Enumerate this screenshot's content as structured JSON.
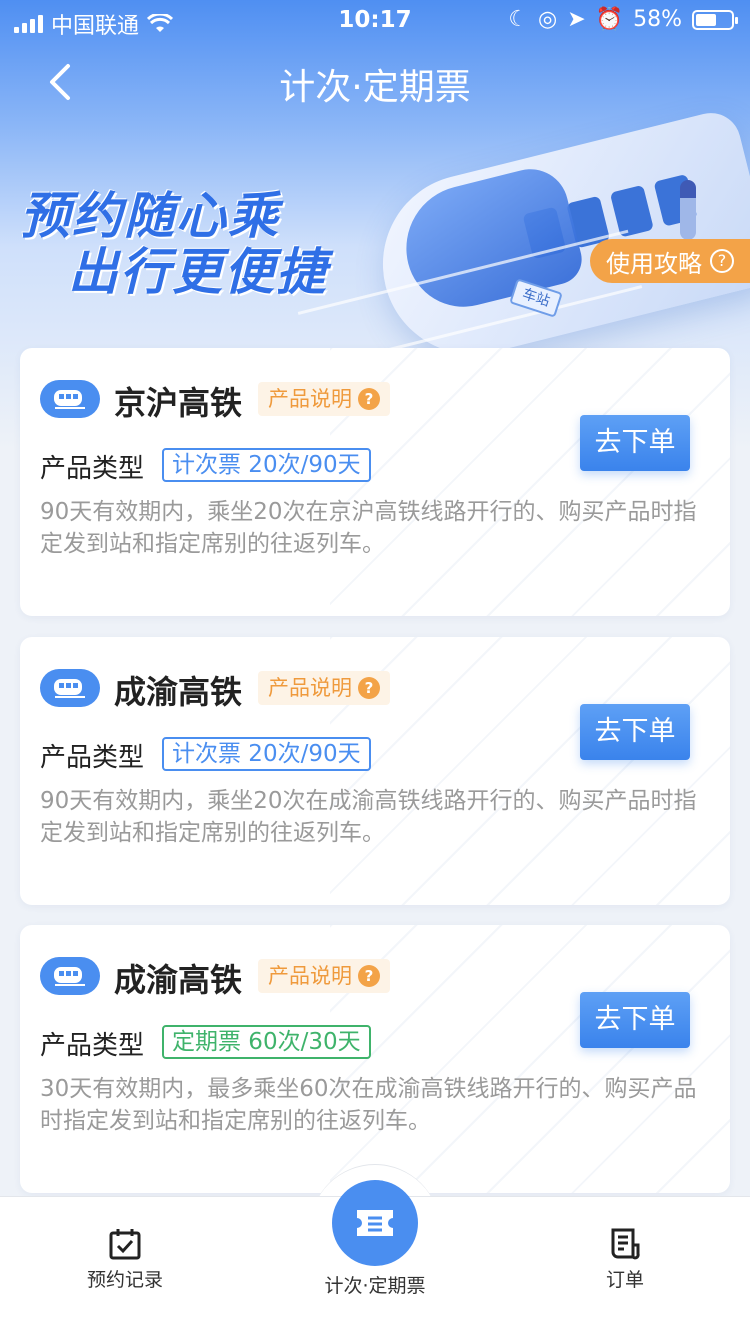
{
  "status_bar": {
    "carrier": "中国联通",
    "time": "10:17",
    "battery": "58%"
  },
  "nav": {
    "title": "计次·定期票"
  },
  "hero": {
    "slogan_line1": "预约随心乘",
    "slogan_line2": "出行更便捷",
    "station_sign": "车站",
    "guide_button": "使用攻略"
  },
  "cards": [
    {
      "name": "京沪高铁",
      "info_tag": "产品说明",
      "type_label": "产品类型",
      "type_tag": "计次票 20次/90天",
      "type_color": "#4a8ef0",
      "order_button": "去下单",
      "description": "90天有效期内，乘坐20次在京沪高铁线路开行的、购买产品时指定发到站和指定席别的往返列车。"
    },
    {
      "name": "成渝高铁",
      "info_tag": "产品说明",
      "type_label": "产品类型",
      "type_tag": "计次票 20次/90天",
      "type_color": "#4a8ef0",
      "order_button": "去下单",
      "description": "90天有效期内，乘坐20次在成渝高铁线路开行的、购买产品时指定发到站和指定席别的往返列车。"
    },
    {
      "name": "成渝高铁",
      "info_tag": "产品说明",
      "type_label": "产品类型",
      "type_tag": "定期票 60次/30天",
      "type_color": "#3fb36b",
      "order_button": "去下单",
      "description": "30天有效期内，最多乘坐60次在成渝高铁线路开行的、购买产品时指定发到站和指定席别的往返列车。"
    }
  ],
  "tabbar": {
    "records": "预约记录",
    "tickets": "计次·定期票",
    "orders": "订单"
  },
  "colors": {
    "primary": "#4a8ef0",
    "accent_orange": "#f3a348",
    "green": "#3fb36b"
  }
}
